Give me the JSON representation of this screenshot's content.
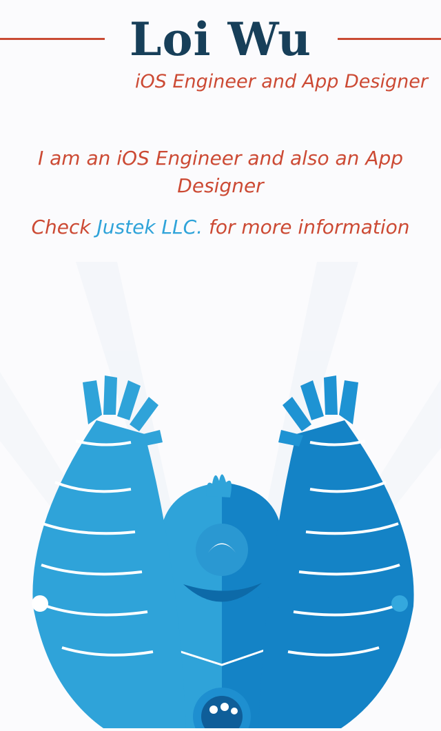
{
  "header": {
    "name": "Loi Wu",
    "tagline": "iOS Engineer and App Designer"
  },
  "intro": {
    "text": "I am an iOS Engineer and also an App Designer"
  },
  "cta": {
    "prefix": "Check ",
    "link_text": "Justek LLC.",
    "suffix": " for more information"
  },
  "colors": {
    "accent": "#cc4a34",
    "heading": "#173f59",
    "link": "#2fa3d9",
    "mascot_light": "#2fa3d9",
    "mascot_dark": "#1483c6"
  },
  "hero": {
    "icon": "mascot-illustration"
  }
}
